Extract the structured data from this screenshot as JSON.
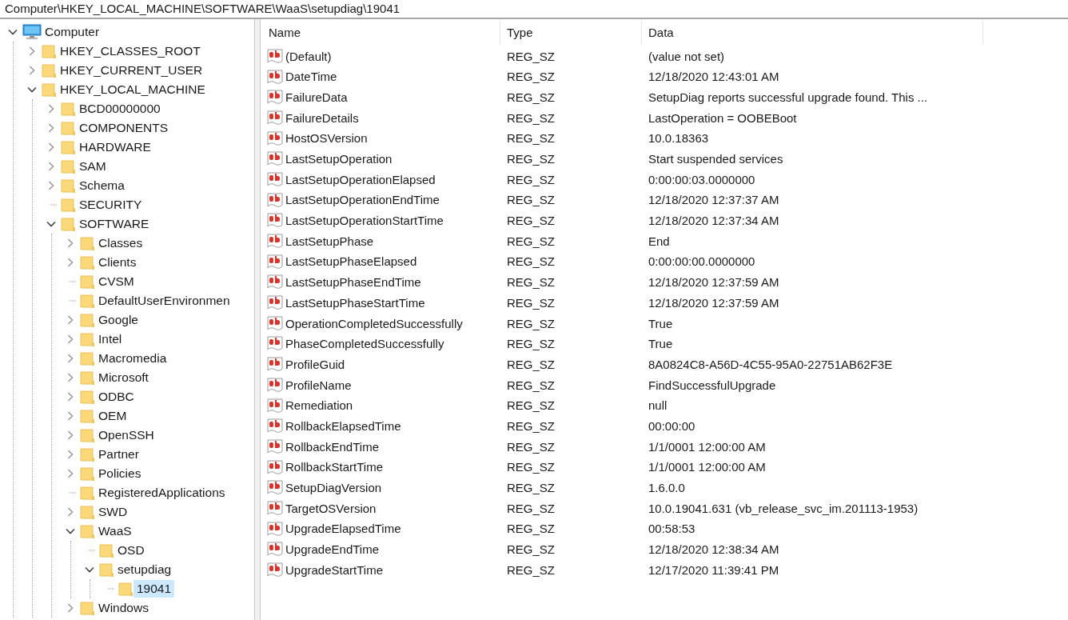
{
  "address_bar": {
    "path": "Computer\\HKEY_LOCAL_MACHINE\\SOFTWARE\\WaaS\\setupdiag\\19041"
  },
  "tree": [
    {
      "label": "Computer",
      "kind": "computer",
      "expanded": true,
      "selected": false,
      "children": [
        {
          "label": "HKEY_CLASSES_ROOT",
          "kind": "folder",
          "expanded": false,
          "selected": false
        },
        {
          "label": "HKEY_CURRENT_USER",
          "kind": "folder",
          "expanded": false,
          "selected": false
        },
        {
          "label": "HKEY_LOCAL_MACHINE",
          "kind": "folder",
          "expanded": true,
          "selected": false,
          "children": [
            {
              "label": "BCD00000000",
              "kind": "folder",
              "expanded": false,
              "selected": false
            },
            {
              "label": "COMPONENTS",
              "kind": "folder",
              "expanded": false,
              "selected": false
            },
            {
              "label": "HARDWARE",
              "kind": "folder",
              "expanded": false,
              "selected": false
            },
            {
              "label": "SAM",
              "kind": "folder",
              "expanded": false,
              "selected": false
            },
            {
              "label": "Schema",
              "kind": "folder",
              "expanded": false,
              "selected": false
            },
            {
              "label": "SECURITY",
              "kind": "folder",
              "selected": false
            },
            {
              "label": "SOFTWARE",
              "kind": "folder",
              "expanded": true,
              "selected": false,
              "children": [
                {
                  "label": "Classes",
                  "kind": "folder",
                  "expanded": false,
                  "selected": false
                },
                {
                  "label": "Clients",
                  "kind": "folder",
                  "expanded": false,
                  "selected": false
                },
                {
                  "label": "CVSM",
                  "kind": "folder",
                  "selected": false
                },
                {
                  "label": "DefaultUserEnvironmen",
                  "kind": "folder",
                  "selected": false
                },
                {
                  "label": "Google",
                  "kind": "folder",
                  "expanded": false,
                  "selected": false
                },
                {
                  "label": "Intel",
                  "kind": "folder",
                  "expanded": false,
                  "selected": false
                },
                {
                  "label": "Macromedia",
                  "kind": "folder",
                  "expanded": false,
                  "selected": false
                },
                {
                  "label": "Microsoft",
                  "kind": "folder",
                  "expanded": false,
                  "selected": false
                },
                {
                  "label": "ODBC",
                  "kind": "folder",
                  "expanded": false,
                  "selected": false
                },
                {
                  "label": "OEM",
                  "kind": "folder",
                  "expanded": false,
                  "selected": false
                },
                {
                  "label": "OpenSSH",
                  "kind": "folder",
                  "expanded": false,
                  "selected": false
                },
                {
                  "label": "Partner",
                  "kind": "folder",
                  "expanded": false,
                  "selected": false
                },
                {
                  "label": "Policies",
                  "kind": "folder",
                  "expanded": false,
                  "selected": false
                },
                {
                  "label": "RegisteredApplications",
                  "kind": "folder",
                  "selected": false
                },
                {
                  "label": "SWD",
                  "kind": "folder",
                  "expanded": false,
                  "selected": false
                },
                {
                  "label": "WaaS",
                  "kind": "folder",
                  "expanded": true,
                  "selected": false,
                  "children": [
                    {
                      "label": "OSD",
                      "kind": "folder",
                      "selected": false
                    },
                    {
                      "label": "setupdiag",
                      "kind": "folder",
                      "expanded": true,
                      "selected": false,
                      "children": [
                        {
                          "label": "19041",
                          "kind": "folder",
                          "selected": true
                        }
                      ]
                    }
                  ]
                },
                {
                  "label": "Windows",
                  "kind": "folder",
                  "expanded": false,
                  "selected": false
                }
              ]
            }
          ]
        }
      ]
    }
  ],
  "table": {
    "columns": [
      "Name",
      "Type",
      "Data"
    ],
    "rows": [
      {
        "name": "(Default)",
        "type": "REG_SZ",
        "data": "(value not set)"
      },
      {
        "name": "DateTime",
        "type": "REG_SZ",
        "data": "12/18/2020 12:43:01 AM"
      },
      {
        "name": "FailureData",
        "type": "REG_SZ",
        "data": "SetupDiag reports successful upgrade found. This ..."
      },
      {
        "name": "FailureDetails",
        "type": "REG_SZ",
        "data": "LastOperation = OOBEBoot"
      },
      {
        "name": "HostOSVersion",
        "type": "REG_SZ",
        "data": "10.0.18363"
      },
      {
        "name": "LastSetupOperation",
        "type": "REG_SZ",
        "data": "Start suspended services"
      },
      {
        "name": "LastSetupOperationElapsed",
        "type": "REG_SZ",
        "data": "0:00:00:03.0000000"
      },
      {
        "name": "LastSetupOperationEndTime",
        "type": "REG_SZ",
        "data": "12/18/2020 12:37:37 AM"
      },
      {
        "name": "LastSetupOperationStartTime",
        "type": "REG_SZ",
        "data": "12/18/2020 12:37:34 AM"
      },
      {
        "name": "LastSetupPhase",
        "type": "REG_SZ",
        "data": "End"
      },
      {
        "name": "LastSetupPhaseElapsed",
        "type": "REG_SZ",
        "data": "0:00:00:00.0000000"
      },
      {
        "name": "LastSetupPhaseEndTime",
        "type": "REG_SZ",
        "data": "12/18/2020 12:37:59 AM"
      },
      {
        "name": "LastSetupPhaseStartTime",
        "type": "REG_SZ",
        "data": "12/18/2020 12:37:59 AM"
      },
      {
        "name": "OperationCompletedSuccessfully",
        "type": "REG_SZ",
        "data": "True"
      },
      {
        "name": "PhaseCompletedSuccessfully",
        "type": "REG_SZ",
        "data": "True"
      },
      {
        "name": "ProfileGuid",
        "type": "REG_SZ",
        "data": "8A0824C8-A56D-4C55-95A0-22751AB62F3E"
      },
      {
        "name": "ProfileName",
        "type": "REG_SZ",
        "data": "FindSuccessfulUpgrade"
      },
      {
        "name": "Remediation",
        "type": "REG_SZ",
        "data": "null"
      },
      {
        "name": "RollbackElapsedTime",
        "type": "REG_SZ",
        "data": "00:00:00"
      },
      {
        "name": "RollbackEndTime",
        "type": "REG_SZ",
        "data": "1/1/0001 12:00:00 AM"
      },
      {
        "name": "RollbackStartTime",
        "type": "REG_SZ",
        "data": "1/1/0001 12:00:00 AM"
      },
      {
        "name": "SetupDiagVersion",
        "type": "REG_SZ",
        "data": "1.6.0.0"
      },
      {
        "name": "TargetOSVersion",
        "type": "REG_SZ",
        "data": "10.0.19041.631 (vb_release_svc_im.201113-1953)"
      },
      {
        "name": "UpgradeElapsedTime",
        "type": "REG_SZ",
        "data": "00:58:53"
      },
      {
        "name": "UpgradeEndTime",
        "type": "REG_SZ",
        "data": "12/18/2020 12:38:34 AM"
      },
      {
        "name": "UpgradeStartTime",
        "type": "REG_SZ",
        "data": "12/17/2020 11:39:41 PM"
      }
    ]
  }
}
